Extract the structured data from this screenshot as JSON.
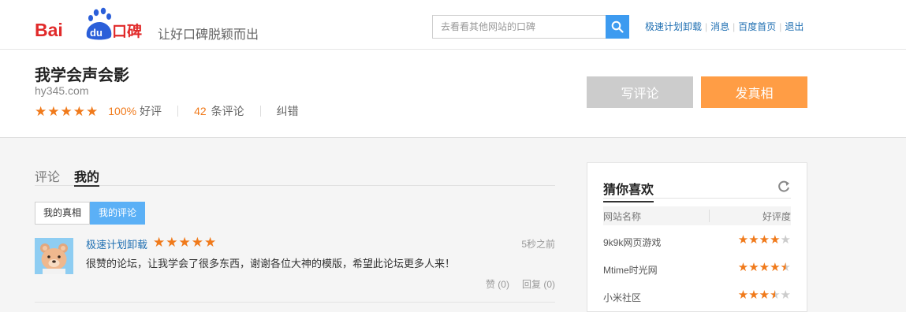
{
  "header": {
    "logo_text": "Bai du 口碑",
    "slogan": "让好口碑脱颖而出",
    "search_placeholder": "去看看其他网站的口碑",
    "links": [
      "极速计划卸载",
      "消息",
      "百度首页",
      "退出"
    ]
  },
  "site": {
    "title": "我学会声会影",
    "domain": "hy345.com",
    "rating_stars": 5,
    "good_pct": "100%",
    "good_label": "好评",
    "review_count": "42",
    "review_label": "条评论",
    "correct_label": "纠错",
    "write_button": "写评论",
    "post_button": "发真相"
  },
  "tabs": [
    "评论",
    "我的"
  ],
  "subtabs": [
    "我的真相",
    "我的评论"
  ],
  "review": {
    "user": "极速计划卸载",
    "stars": 5,
    "time": "5秒之前",
    "text": "很赞的论坛，让我学会了很多东西，谢谢各位大神的模版，希望此论坛更多人来！",
    "like": "赞 (0)",
    "reply": "回复 (0)"
  },
  "side": {
    "title": "猜你喜欢",
    "col_site": "网站名称",
    "col_score": "好评度",
    "items": [
      {
        "name": "9k9k网页游戏",
        "rating": 4
      },
      {
        "name": "Mtime时光网",
        "rating": 4.5
      },
      {
        "name": "小米社区",
        "rating": 3.5
      }
    ]
  },
  "colors": {
    "accent_orange": "#f07a1b",
    "link_blue": "#1f6fb2",
    "search_blue": "#3d9bf0",
    "post_button": "#ff9d45",
    "write_button": "#cccccc",
    "active_subtab": "#5bb0f6"
  }
}
